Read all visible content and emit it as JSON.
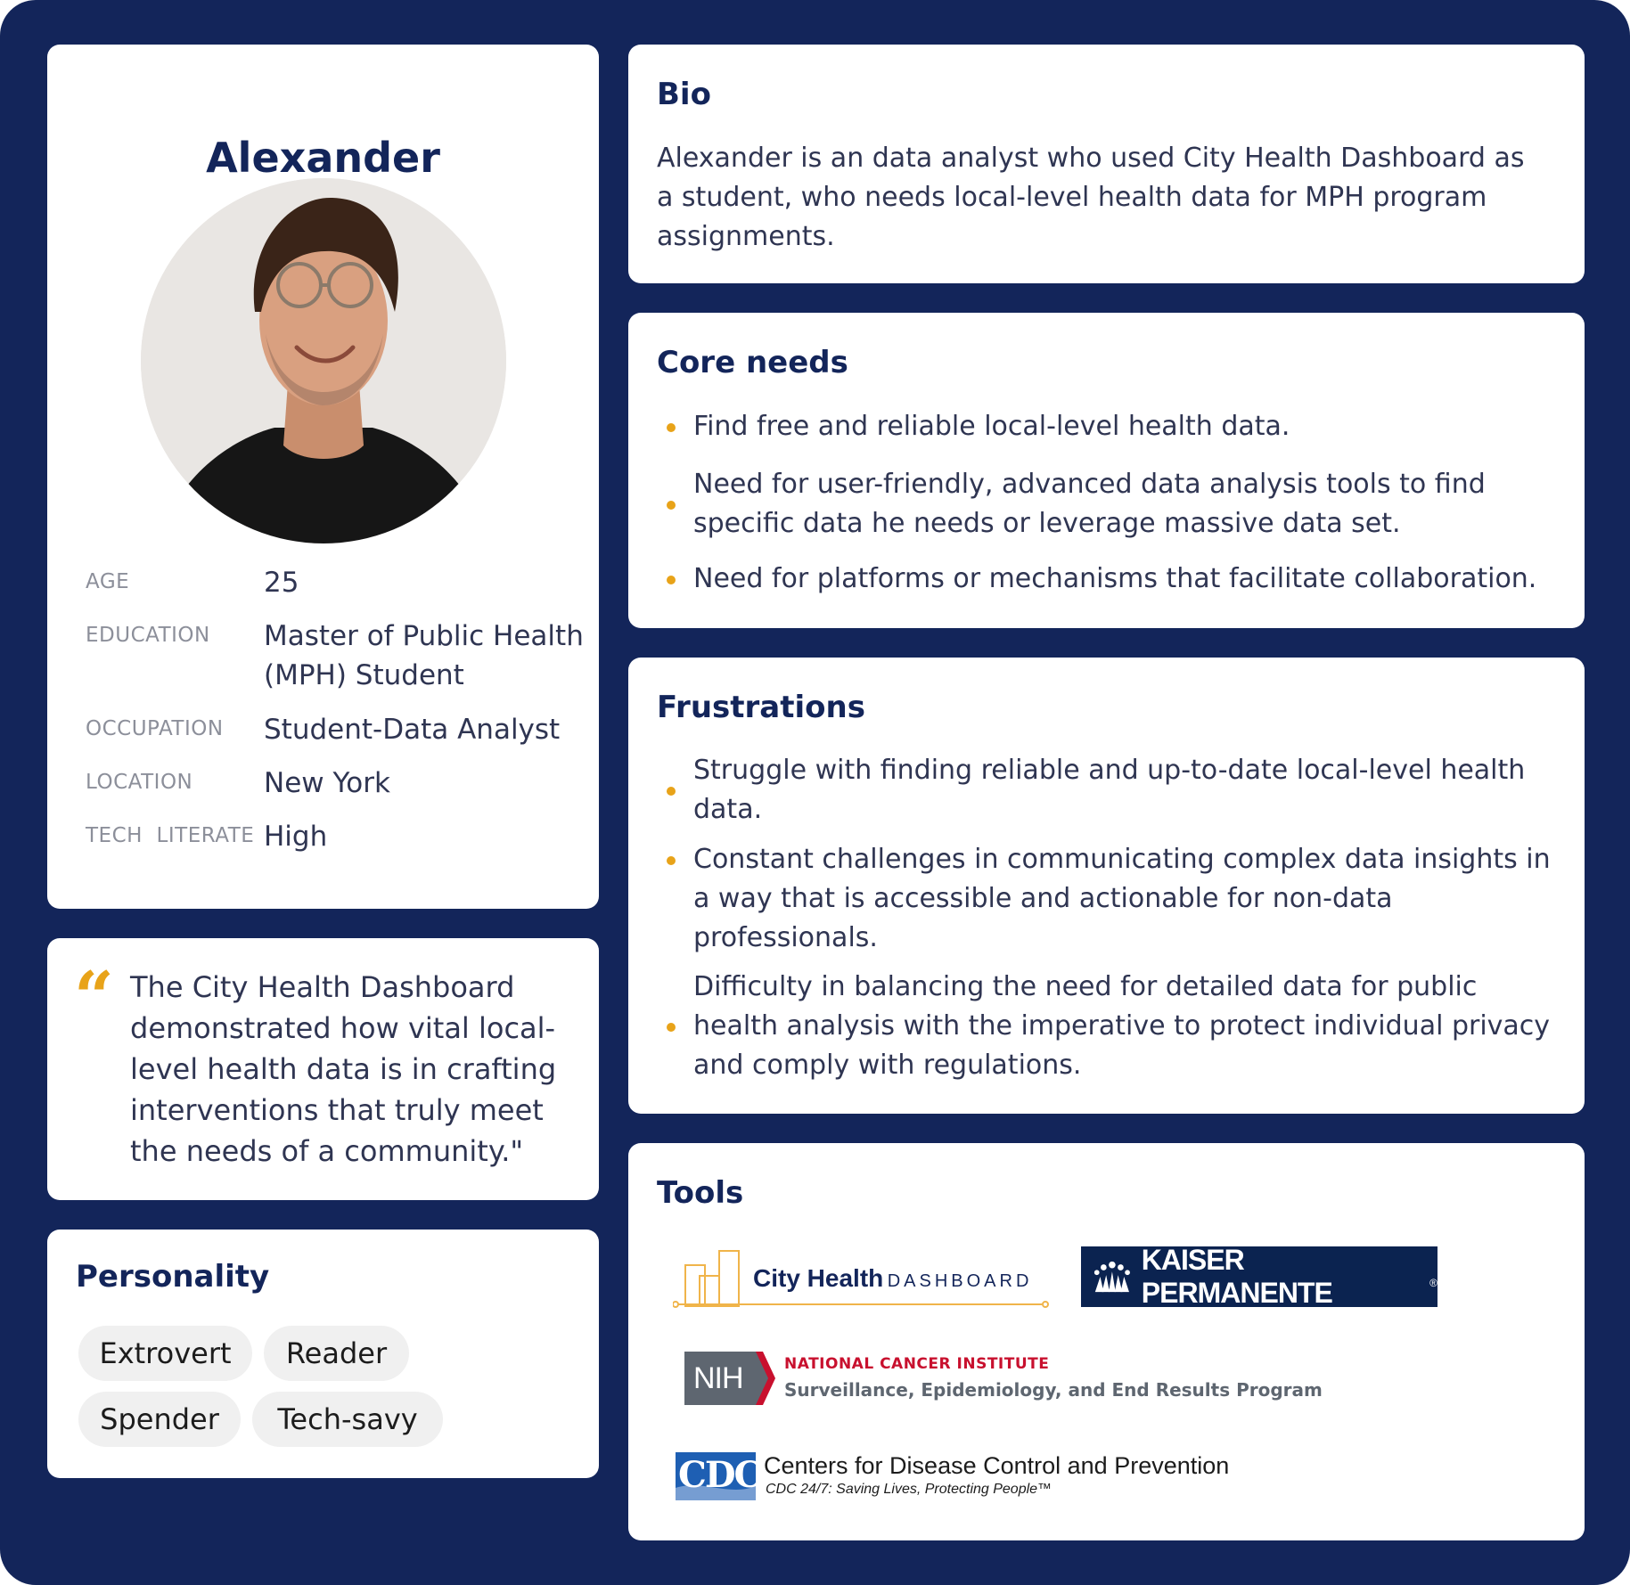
{
  "profile": {
    "name": "Alexander",
    "attributes": [
      {
        "label": "AGE",
        "value": "25"
      },
      {
        "label": "EDUCATION",
        "value": "Master of Public Health (MPH) Student"
      },
      {
        "label": "OCCUPATION",
        "value": "Student-Data Analyst"
      },
      {
        "label": "LOCATION",
        "value": "New York"
      },
      {
        "label": "TECH  LITERATE",
        "value": "High"
      }
    ]
  },
  "quote": {
    "mark": "“",
    "text": "The City Health Dashboard demonstrated how vital local-level health data is in crafting interventions that truly meet the needs of a community.\""
  },
  "personality": {
    "title": "Personality",
    "traits": [
      "Extrovert",
      "Reader",
      "Spender",
      "Tech-savy"
    ]
  },
  "bio": {
    "title": "Bio",
    "text": "Alexander is an data analyst who used City Health Dashboard as a student, who needs local-level health data for MPH program assignments."
  },
  "core_needs": {
    "title": "Core needs",
    "items": [
      "Find free and reliable local-level health data.",
      "Need for user-friendly, advanced data analysis tools to find specific data he needs or leverage massive data set.",
      "Need for platforms or mechanisms that facilitate collaboration."
    ]
  },
  "frustrations": {
    "title": "Frustrations",
    "items": [
      "Struggle with finding reliable and up-to-date local-level health data.",
      "Constant challenges in communicating complex data insights in a way that is accessible and actionable for non-data professionals.",
      "Difficulty in balancing the need for detailed data for public health analysis with the imperative to protect individual privacy and comply with regulations."
    ]
  },
  "tools": {
    "title": "Tools",
    "city_health": {
      "bold": "City Health",
      "light": "DASHBOARD"
    },
    "kaiser": {
      "text": "KAISER PERMANENTE",
      "mark": "®"
    },
    "nih": {
      "badge": "NIH",
      "line1": "NATIONAL CANCER INSTITUTE",
      "line2": "Surveillance, Epidemiology, and End Results Program"
    },
    "cdc": {
      "badge": "CDC",
      "line1": "Centers for Disease Control and Prevention",
      "line2": "CDC 24/7: Saving Lives, Protecting People™"
    }
  },
  "colors": {
    "background": "#13255a",
    "card": "#ffffff",
    "accent": "#e8a319",
    "heading": "#13255a",
    "chip": "#f0f0f0"
  }
}
